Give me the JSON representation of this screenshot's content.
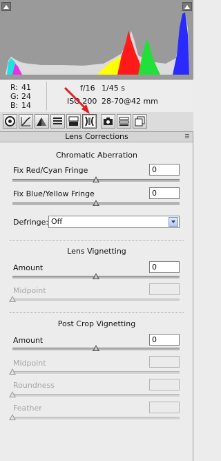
{
  "histogram": {
    "clip_shadows_label": "shadow clipping warning",
    "clip_highlights_label": "highlight clipping warning"
  },
  "readout": {
    "r_label": "R:",
    "r_value": "41",
    "g_label": "G:",
    "g_value": "24",
    "b_label": "B:",
    "b_value": "14",
    "aperture": "f/16",
    "shutter": "1/45 s",
    "iso": "ISO 200",
    "lens": "28-70@42 mm"
  },
  "toolbar": {
    "tabs": [
      "basic-tab",
      "tone-curve-tab",
      "detail-tab",
      "hsl-tab",
      "split-toning-tab",
      "lens-corrections-tab",
      "camera-calibration-tab",
      "presets-tab",
      "snapshots-tab"
    ],
    "active_tab": "lens-corrections-tab"
  },
  "panel": {
    "title": "Lens Corrections",
    "chromatic": {
      "title": "Chromatic Aberration",
      "red_cyan_label": "Fix Red/Cyan Fringe",
      "red_cyan_value": "0",
      "red_cyan_level": 0,
      "blue_yellow_label": "Fix Blue/Yellow Fringe",
      "blue_yellow_value": "0",
      "blue_yellow_level": 0,
      "defringe_label": "Defringe:",
      "defringe_value": "Off"
    },
    "vignetting": {
      "title": "Lens Vignetting",
      "amount_label": "Amount",
      "amount_value": "0",
      "amount_level": 0,
      "midpoint_label": "Midpoint",
      "midpoint_value": ""
    },
    "post_crop": {
      "title": "Post Crop Vignetting",
      "amount_label": "Amount",
      "amount_value": "0",
      "amount_level": 0,
      "midpoint_label": "Midpoint",
      "roundness_label": "Roundness",
      "feather_label": "Feather"
    }
  },
  "colors": {
    "arrow": "#e02020",
    "histogram_bg": "#9a9a9a",
    "red_channel": "#ff1a1a",
    "green_channel": "#22e03a",
    "blue_channel": "#2a2aff",
    "yellow_channel": "#ffff00",
    "magenta_channel": "#e830e8",
    "cyan_channel": "#22e0e0"
  }
}
